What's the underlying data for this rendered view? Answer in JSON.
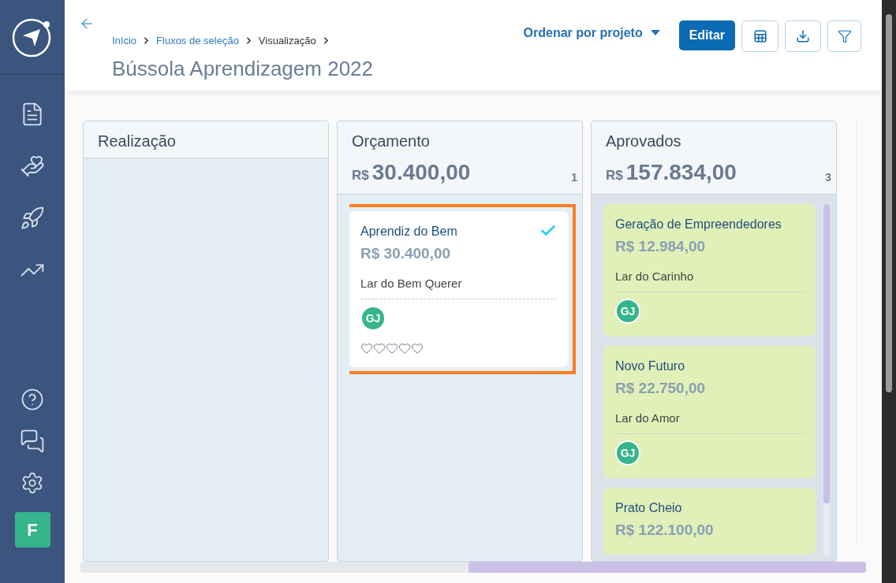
{
  "breadcrumb": [
    {
      "label": "Início",
      "link": true
    },
    {
      "label": "Fluxos de seleção",
      "link": true
    },
    {
      "label": "Visualização",
      "link": false
    }
  ],
  "page_title": "Bússola Aprendizagem 2022",
  "sort_menu": {
    "label": "Ordenar por projeto"
  },
  "edit_button": "Editar",
  "user_badge": "F",
  "columns": [
    {
      "title": "Realização"
    },
    {
      "title": "Orçamento",
      "currency": "R$",
      "total": "30.400,00",
      "count": "1",
      "cards": [
        {
          "name": "Aprendiz do Bem",
          "amount": "R$ 30.400,00",
          "org": "Lar do Bem Querer",
          "avatar": "GJ",
          "selected": true,
          "checked": true,
          "color": "#ffffff",
          "stars": 0
        }
      ]
    },
    {
      "title": "Aprovados",
      "currency": "R$",
      "total": "157.834,00",
      "count": "3",
      "cards": [
        {
          "name": "Geração de Empreendedores",
          "amount": "R$ 12.984,00",
          "org": "Lar do Carinho",
          "avatar": "GJ",
          "selected": false,
          "checked": false,
          "color": "#e0f0b8"
        },
        {
          "name": "Novo Futuro",
          "amount": "R$ 22.750,00",
          "org": "Lar do Amor",
          "avatar": "GJ",
          "selected": false,
          "checked": false,
          "color": "#e0f0b8"
        },
        {
          "name": "Prato Cheio",
          "amount": "R$ 122.100,00",
          "selected": false,
          "checked": false,
          "color": "#e0f0b8"
        }
      ]
    }
  ]
}
